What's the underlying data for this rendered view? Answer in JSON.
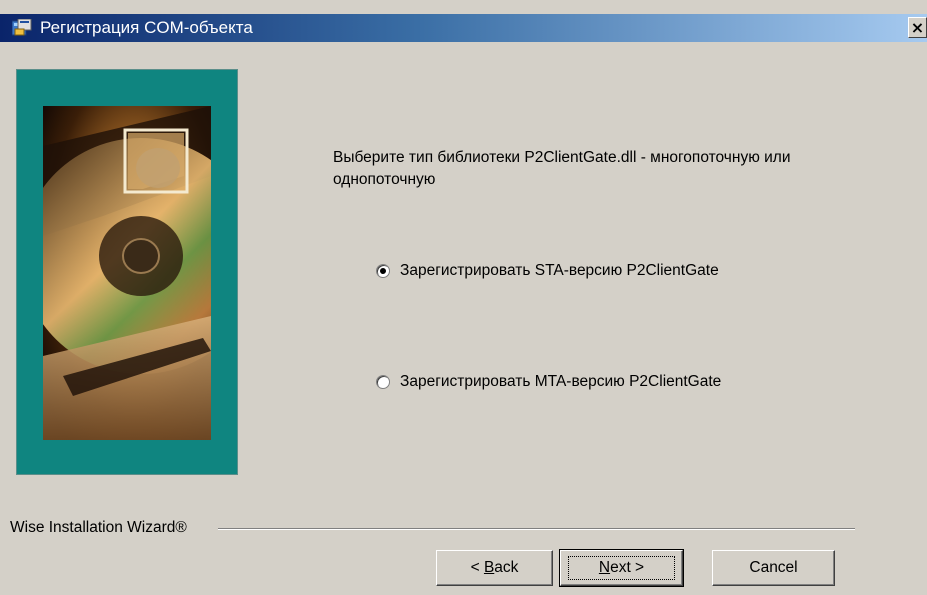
{
  "window": {
    "title": "Регистрация COM-объекта",
    "close_glyph": "×"
  },
  "main": {
    "prompt": "Выберите тип библиотеки P2ClientGate.dll - многопоточную или однопоточную",
    "options": [
      {
        "label": "Зарегистрировать STA-версию P2ClientGate",
        "selected": true
      },
      {
        "label": "Зарегистрировать MTA-версию P2ClientGate",
        "selected": false
      }
    ]
  },
  "footer": {
    "brand": "Wise Installation Wizard®",
    "back_prefix": "< ",
    "back_mnemonic": "B",
    "back_rest": "ack",
    "next_mnemonic": "N",
    "next_rest": "ext >",
    "cancel_label": "Cancel"
  },
  "icons": {
    "title_icon": "installer-app-icon",
    "banner": "cd-disc-graphic"
  },
  "colors": {
    "title_start": "#0a246a",
    "title_end": "#a6caf0",
    "dialog_bg": "#d4d0c8",
    "banner_teal": "#0f8580"
  }
}
